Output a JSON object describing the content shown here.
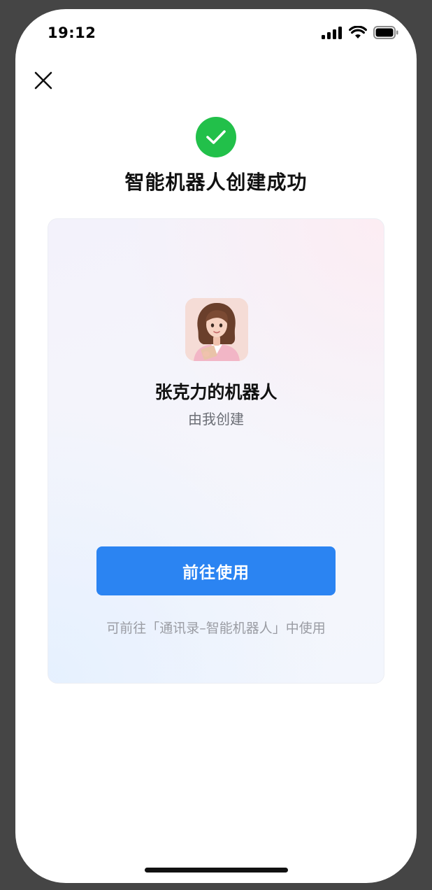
{
  "status_bar": {
    "time": "19:12",
    "icons": [
      "cellular-signal-icon",
      "wifi-icon",
      "battery-icon"
    ]
  },
  "toolbar": {
    "close_icon": "close-icon"
  },
  "success": {
    "icon": "checkmark-icon",
    "title": "智能机器人创建成功"
  },
  "bot": {
    "name": "张克力的机器人",
    "creator": "由我创建"
  },
  "actions": {
    "go_label": "前往使用",
    "hint": "可前往「通讯录–智能机器人」中使用"
  },
  "colors": {
    "accent": "#2b84f2",
    "success": "#22c04a",
    "background_outer": "#454545"
  }
}
